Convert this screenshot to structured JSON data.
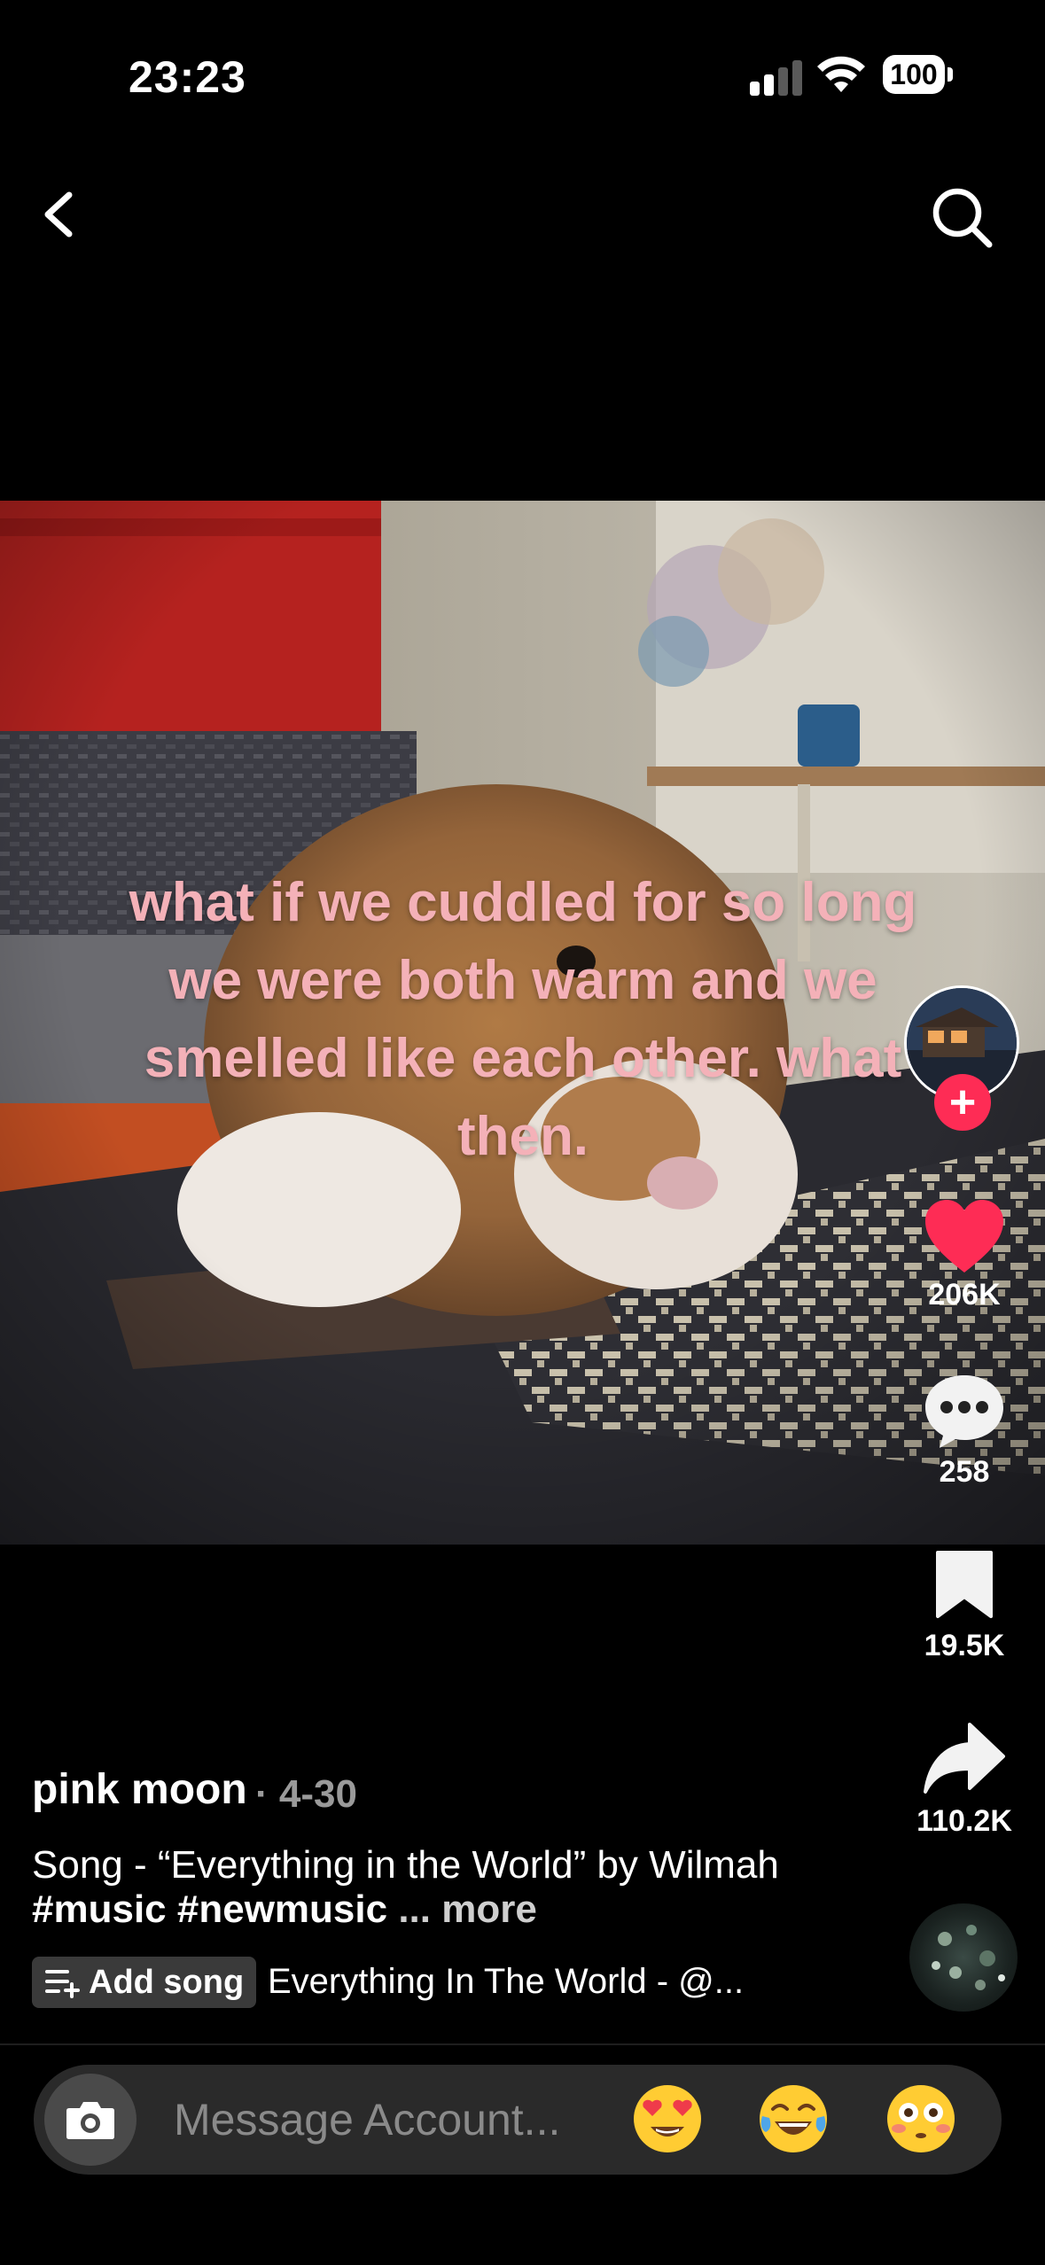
{
  "status_bar": {
    "time": "23:23",
    "battery": "100"
  },
  "nav": {
    "back_icon": "chevron-left-icon",
    "search_icon": "search-icon"
  },
  "video": {
    "overlay_text": "what if we cuddled for so long we were both warm and we smelled like each other. what then.",
    "overlay_color": "#f4b1b8"
  },
  "rail": {
    "likes": "206K",
    "comments": "258",
    "saves": "19.5K",
    "shares": "110.2K",
    "follow_label": "+",
    "like_color": "#fe2c55"
  },
  "post": {
    "author": "pink moon",
    "date": "· 4-30",
    "description_prefix": "Song - “Everything in the World” by Wilmah",
    "hashtag_1": "#music",
    "hashtag_2": "#newmusic",
    "ellipsis": "...",
    "more": "more",
    "add_song_label": "Add song",
    "song_title": "Everything In The World - @..."
  },
  "message_bar": {
    "placeholder": "Message Account...",
    "emojis": [
      "heart-eyes",
      "tears-of-joy",
      "flushed"
    ]
  }
}
